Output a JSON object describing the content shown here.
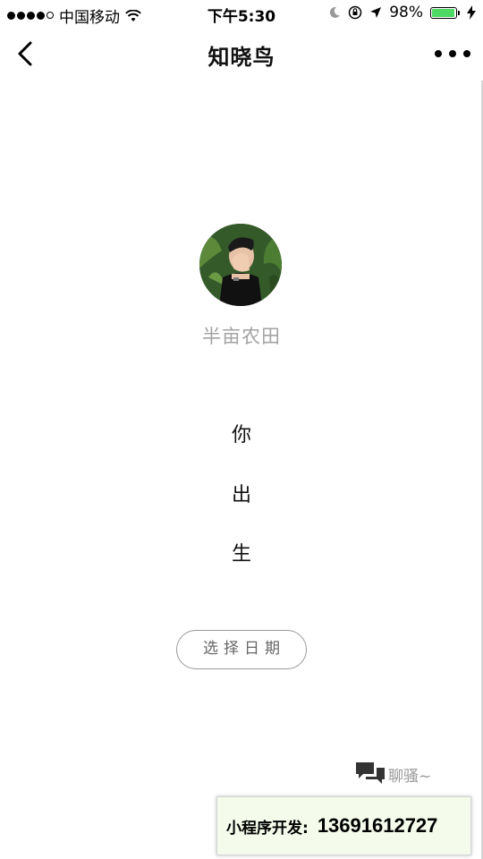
{
  "status_bar": {
    "carrier": "中国移动",
    "time": "下午5:30",
    "battery": "98%",
    "battery_level": 0.98
  },
  "nav": {
    "title": "知晓鸟"
  },
  "profile": {
    "username": "半亩农田"
  },
  "prompt": {
    "char_1": "你",
    "char_2": "出",
    "char_3": "生"
  },
  "actions": {
    "select_date_label": "选择日期",
    "chat_label": "聊骚~"
  },
  "promo": {
    "label": "小程序开发:",
    "phone": "13691612727"
  },
  "colors": {
    "battery_fill": "#4cd964",
    "username": "#a3a3a3",
    "button_border": "#9a9a9a",
    "promo_bg": "#f4fbea"
  }
}
